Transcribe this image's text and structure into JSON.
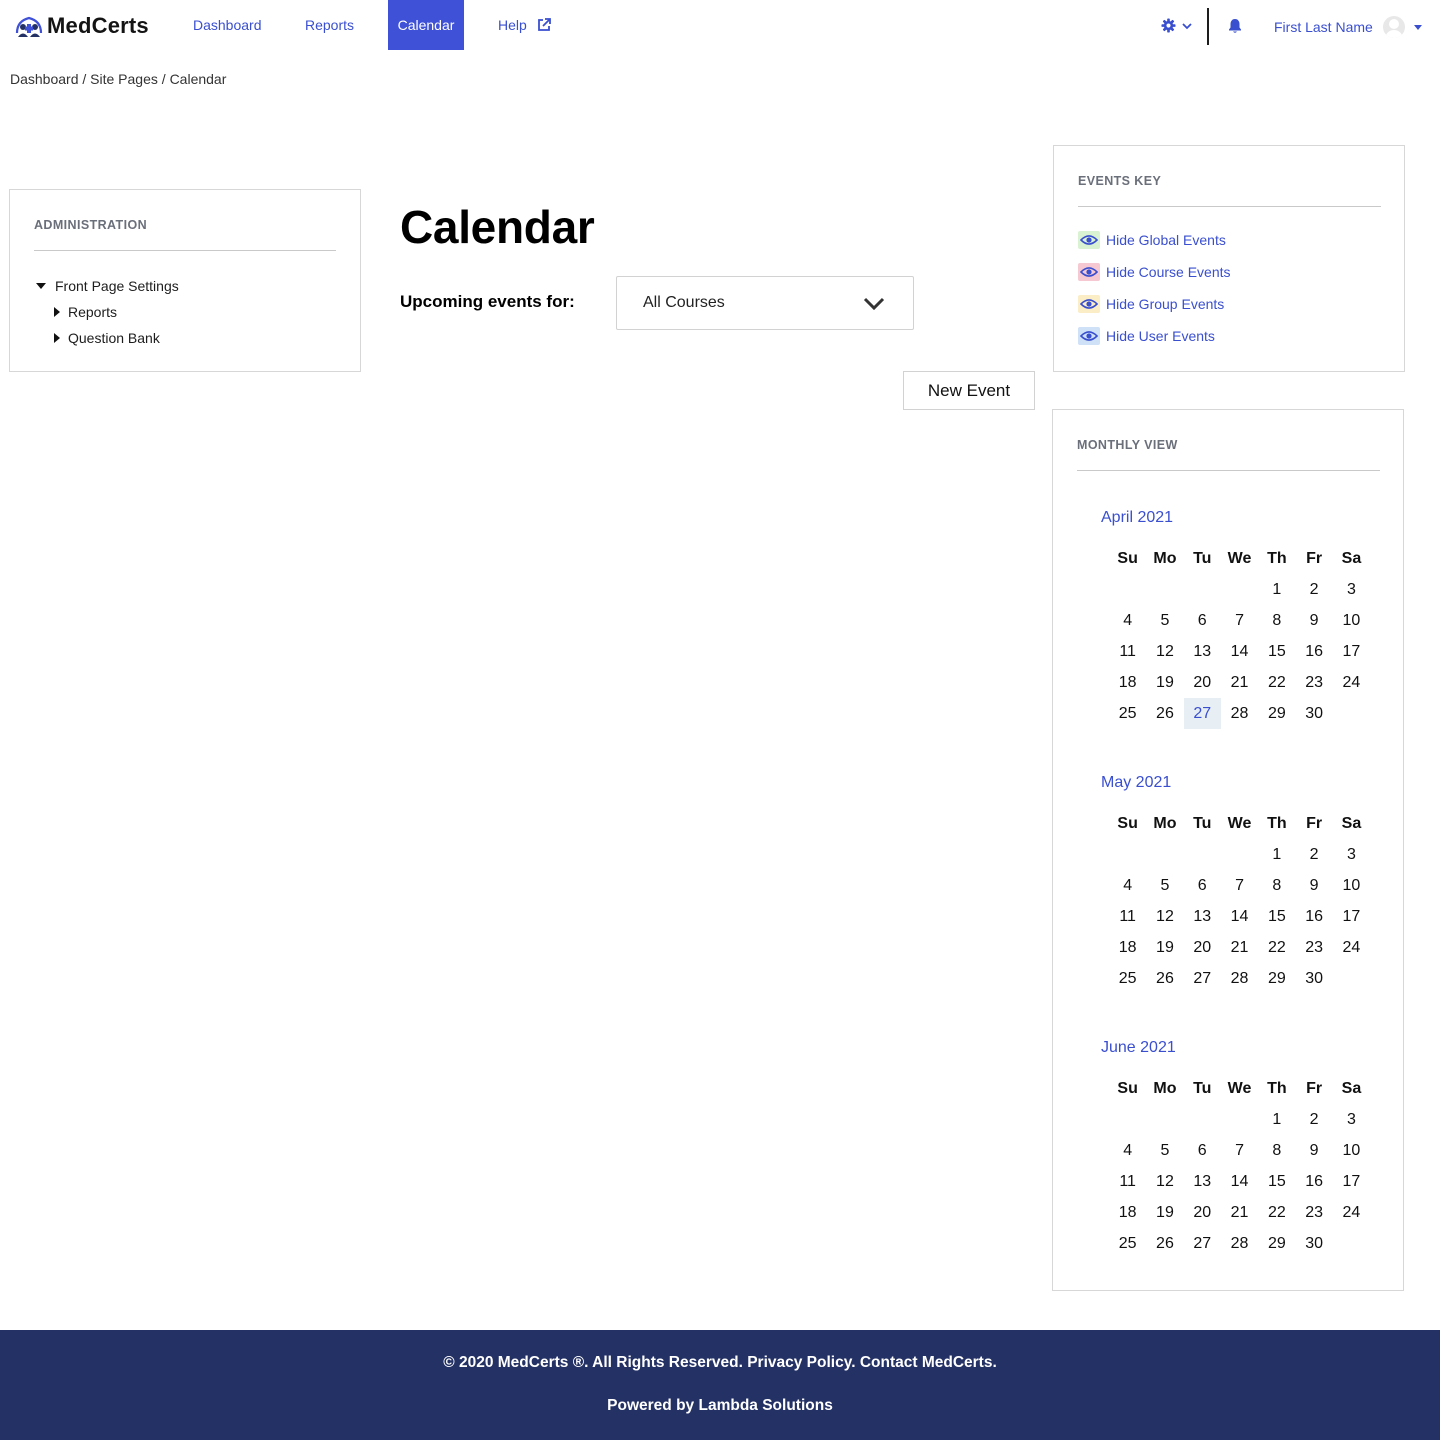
{
  "brand": {
    "name": "MedCerts",
    "accent_color": "#3f51d6"
  },
  "nav": {
    "items": [
      {
        "label": "Dashboard",
        "active": false
      },
      {
        "label": "Reports",
        "active": false
      },
      {
        "label": "Calendar",
        "active": true
      },
      {
        "label": "Help",
        "active": false,
        "icon": "external-link-icon"
      }
    ],
    "settings_icon": "gear-icon",
    "notifications_icon": "bell-icon",
    "user_name": "First Last Name"
  },
  "breadcrumb": [
    "Dashboard",
    "Site Pages",
    "Calendar"
  ],
  "admin": {
    "title": "ADMINISTRATION",
    "tree": [
      {
        "label": "Front Page Settings",
        "expanded": true
      },
      {
        "label": "Reports",
        "expanded": false
      },
      {
        "label": "Question Bank",
        "expanded": false
      }
    ]
  },
  "main": {
    "title": "Calendar",
    "upcoming_label": "Upcoming events for:",
    "course_select_value": "All Courses",
    "new_event_label": "New Event"
  },
  "events_key": {
    "title": "EVENTS KEY",
    "items": [
      {
        "label": "Hide Global Events",
        "color": "#d9f2d2"
      },
      {
        "label": "Hide Course Events",
        "color": "#f6c9d2"
      },
      {
        "label": "Hide Group Events",
        "color": "#fbeec7"
      },
      {
        "label": "Hide User Events",
        "color": "#cfe1f7"
      }
    ]
  },
  "monthly_view": {
    "title": "MONTHLY VIEW",
    "weekdays": [
      "Su",
      "Mo",
      "Tu",
      "We",
      "Th",
      "Fr",
      "Sa"
    ],
    "months": [
      {
        "name": "April 2021",
        "weeks": [
          [
            "",
            "",
            "",
            "",
            "1",
            "2",
            "3"
          ],
          [
            "4",
            "5",
            "6",
            "7",
            "8",
            "9",
            "10"
          ],
          [
            "11",
            "12",
            "13",
            "14",
            "15",
            "16",
            "17"
          ],
          [
            "18",
            "19",
            "20",
            "21",
            "22",
            "23",
            "24"
          ],
          [
            "25",
            "26",
            "27",
            "28",
            "29",
            "30",
            ""
          ]
        ],
        "today": "27"
      },
      {
        "name": "May 2021",
        "weeks": [
          [
            "",
            "",
            "",
            "",
            "1",
            "2",
            "3"
          ],
          [
            "4",
            "5",
            "6",
            "7",
            "8",
            "9",
            "10"
          ],
          [
            "11",
            "12",
            "13",
            "14",
            "15",
            "16",
            "17"
          ],
          [
            "18",
            "19",
            "20",
            "21",
            "22",
            "23",
            "24"
          ],
          [
            "25",
            "26",
            "27",
            "28",
            "29",
            "30",
            ""
          ]
        ],
        "today": ""
      },
      {
        "name": "June 2021",
        "weeks": [
          [
            "",
            "",
            "",
            "",
            "1",
            "2",
            "3"
          ],
          [
            "4",
            "5",
            "6",
            "7",
            "8",
            "9",
            "10"
          ],
          [
            "11",
            "12",
            "13",
            "14",
            "15",
            "16",
            "17"
          ],
          [
            "18",
            "19",
            "20",
            "21",
            "22",
            "23",
            "24"
          ],
          [
            "25",
            "26",
            "27",
            "28",
            "29",
            "30",
            ""
          ]
        ],
        "today": ""
      }
    ]
  },
  "footer": {
    "copyright": "© 2020 MedCerts ®. All Rights Reserved.",
    "privacy": "Privacy Policy.",
    "contact": "Contact MedCerts.",
    "powered_by": "Powered by Lambda Solutions"
  }
}
